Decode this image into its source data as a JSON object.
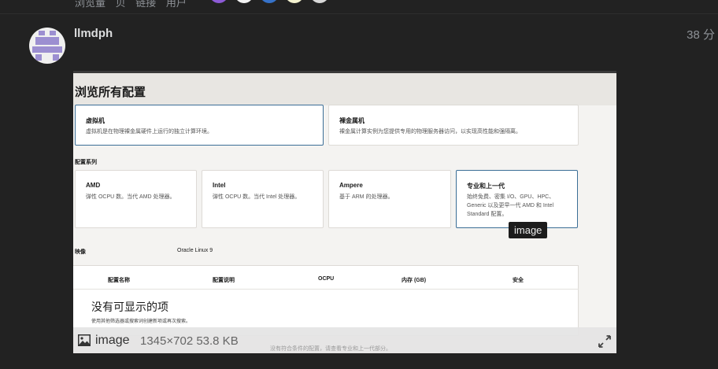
{
  "topbar": {
    "stats_text": "浏览量 贝 链接 用户",
    "participant_colors": [
      "#8d5bd6",
      "#f2f2f2",
      "#3672c9",
      "#f4f2d0",
      "#d8d8d8"
    ]
  },
  "post": {
    "username": "llmdph",
    "time": "38 分"
  },
  "screenshot": {
    "page_title": "浏览所有配置",
    "shape_cards": [
      {
        "title": "虚拟机",
        "desc": "虚拟机是在物理裸金属硬件上运行的独立计算环境。"
      },
      {
        "title": "裸金属机",
        "desc": "裸金属计算实例为您提供专用的物理服务器访问，以实现高性能和强隔离。"
      }
    ],
    "series_label": "配置系列",
    "series_cards": [
      {
        "title": "AMD",
        "desc": "弹性 OCPU 数。当代 AMD 处理器。"
      },
      {
        "title": "Intel",
        "desc": "弹性 OCPU 数。当代 Intel 处理器。"
      },
      {
        "title": "Ampere",
        "desc": "基于 ARM 的处理器。"
      },
      {
        "title": "专业和上一代",
        "desc_line1": "始终免费、密集 I/O、GPU、HPC、",
        "desc_line2": "Generic 以及更早一代 AMD 和 Intel",
        "desc_line3": "Standard 配置。"
      }
    ],
    "image_label": "映像",
    "image_value": "Oracle Linux 9",
    "table_headers": [
      "配置名称",
      "配置说明",
      "OCPU",
      "内存 (GB)",
      "安全"
    ],
    "empty_title": "没有可显示的项",
    "empty_desc": "使用其他筛选器或搜索词创建新项或再次搜索。",
    "faded_hint": "没有符合条件的配置，请查看专业和上一代部分。"
  },
  "tooltip": "image",
  "image_info": {
    "name": "image",
    "meta": "1345×702 53.8 KB",
    "icon": "image-icon",
    "expand_icon": "expand-icon"
  }
}
